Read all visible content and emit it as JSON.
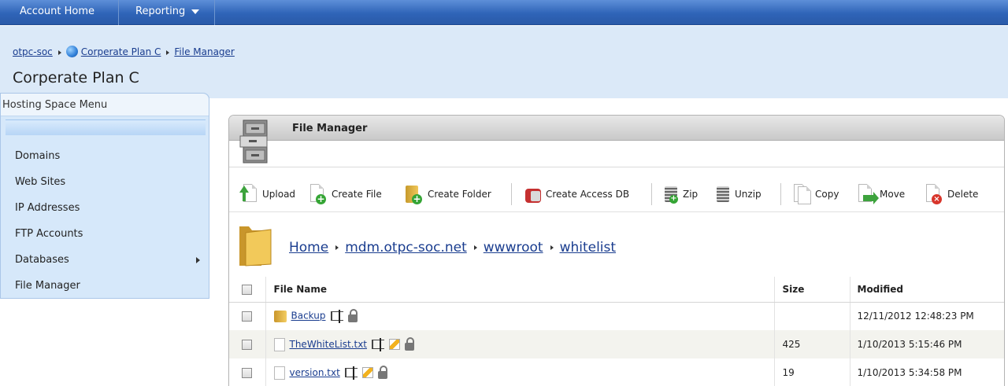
{
  "nav": {
    "account_home": "Account Home",
    "reporting": "Reporting"
  },
  "breadcrumb": {
    "root": "otpc-soc",
    "plan": "Corperate Plan C",
    "current": "File Manager"
  },
  "page_title": "Corperate Plan C",
  "sidebar": {
    "title": "Hosting Space Menu",
    "items": [
      {
        "label": "Domains"
      },
      {
        "label": "Web Sites"
      },
      {
        "label": "IP Addresses"
      },
      {
        "label": "FTP Accounts"
      },
      {
        "label": "Databases",
        "has_submenu": true
      },
      {
        "label": "File Manager"
      }
    ]
  },
  "panel": {
    "title": "File Manager",
    "icon": "file-cabinet-icon"
  },
  "toolbar": {
    "upload": "Upload",
    "create_file": "Create File",
    "create_folder": "Create Folder",
    "create_access_db": "Create Access DB",
    "zip": "Zip",
    "unzip": "Unzip",
    "copy": "Copy",
    "move": "Move",
    "delete": "Delete"
  },
  "path": {
    "home": "Home",
    "domain": "mdm.otpc-soc.net",
    "folder1": "wwwroot",
    "folder2": "whitelist"
  },
  "table": {
    "headers": {
      "name": "File Name",
      "size": "Size",
      "modified": "Modified"
    },
    "rows": [
      {
        "type": "folder",
        "name": "Backup",
        "size": "",
        "modified": "12/11/2012 12:48:23 PM"
      },
      {
        "type": "file",
        "name": "TheWhiteList.txt",
        "size": "425",
        "modified": "1/10/2013 5:15:46 PM"
      },
      {
        "type": "file",
        "name": "version.txt",
        "size": "19",
        "modified": "1/10/2013 5:34:58 PM"
      }
    ]
  },
  "colors": {
    "nav_blue": "#2f64b8",
    "band": "#dbe9f8",
    "link": "#1a3d8f"
  }
}
